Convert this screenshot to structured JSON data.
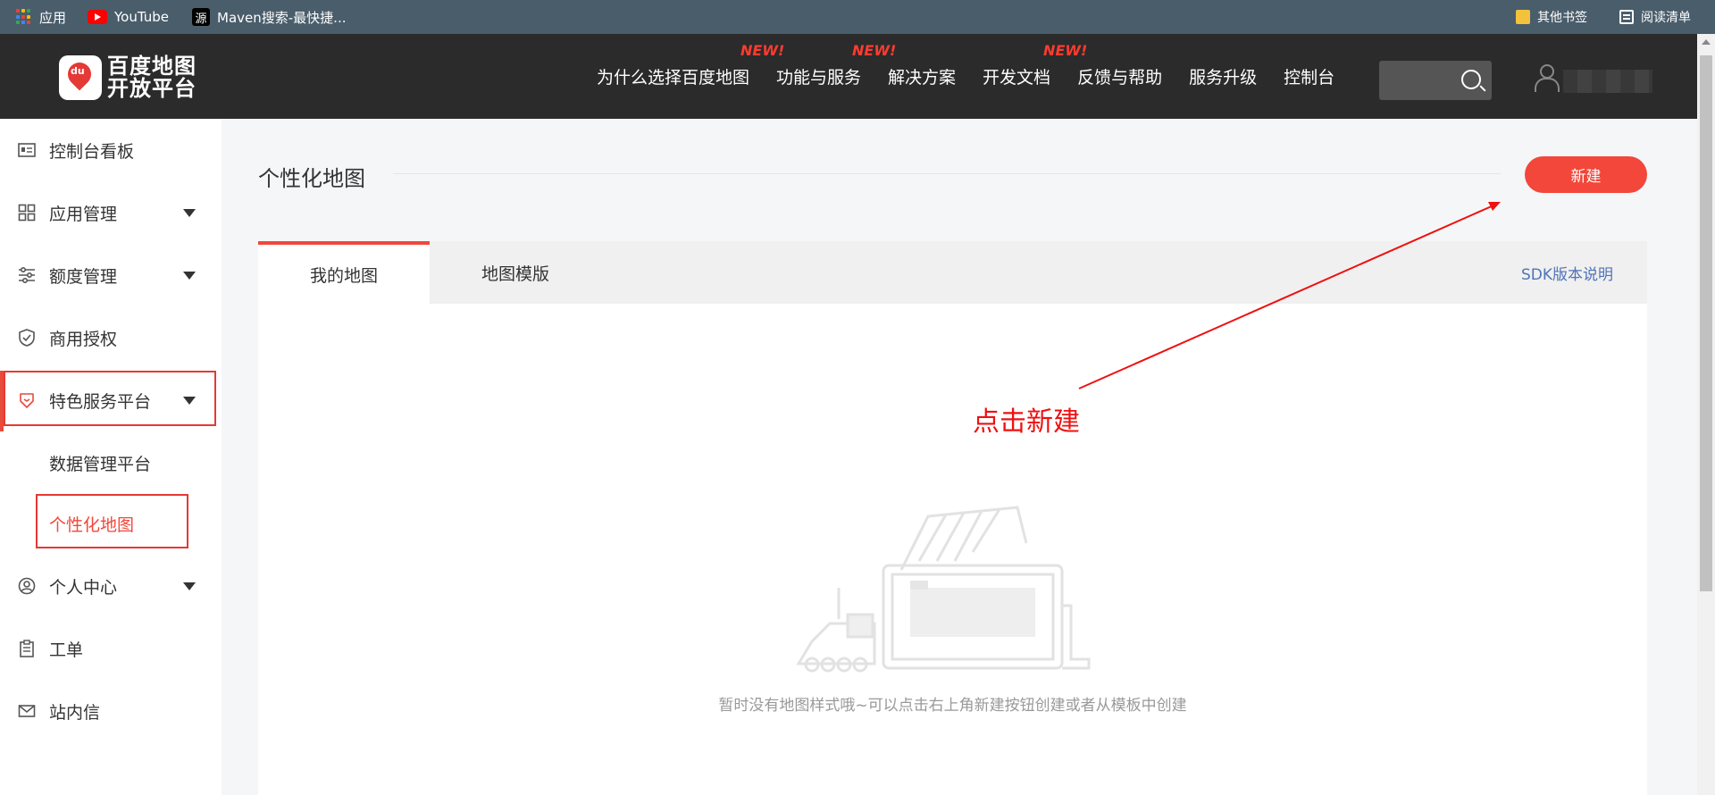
{
  "bookmarks": {
    "apps": "应用",
    "youtube": "YouTube",
    "maven": "Maven搜索-最快捷...",
    "maven_icon": "源",
    "other": "其他书签",
    "reading": "阅读清单"
  },
  "header": {
    "logo_line1": "百度地图",
    "logo_line2": "开放平台",
    "logo_du": "du",
    "nav": [
      {
        "label": "为什么选择百度地图",
        "badge": ""
      },
      {
        "label": "功能与服务",
        "badge": "NEW!"
      },
      {
        "label": "解决方案",
        "badge": "NEW!"
      },
      {
        "label": "开发文档",
        "badge": "NEW!"
      },
      {
        "label": "反馈与帮助",
        "badge": ""
      },
      {
        "label": "服务升级",
        "badge": ""
      },
      {
        "label": "控制台",
        "badge": ""
      }
    ]
  },
  "sidebar": {
    "items": [
      {
        "label": "控制台看板"
      },
      {
        "label": "应用管理"
      },
      {
        "label": "额度管理"
      },
      {
        "label": "商用授权"
      },
      {
        "label": "特色服务平台"
      },
      {
        "label": "数据管理平台"
      },
      {
        "label": "个性化地图"
      },
      {
        "label": "个人中心"
      },
      {
        "label": "工单"
      },
      {
        "label": "站内信"
      }
    ]
  },
  "main": {
    "title": "个性化地图",
    "new_button": "新建",
    "tabs": [
      {
        "label": "我的地图"
      },
      {
        "label": "地图模版"
      }
    ],
    "sdk_link": "SDK版本说明",
    "annotation": "点击新建",
    "empty_text": "暂时没有地图样式哦~可以点击右上角新建按钮创建或者从模板中创建"
  },
  "colors": {
    "accent": "#f2473a",
    "header_bg": "#2b2b2b",
    "bookmarks_bg": "#4a5d6b",
    "link": "#4f73b8"
  }
}
